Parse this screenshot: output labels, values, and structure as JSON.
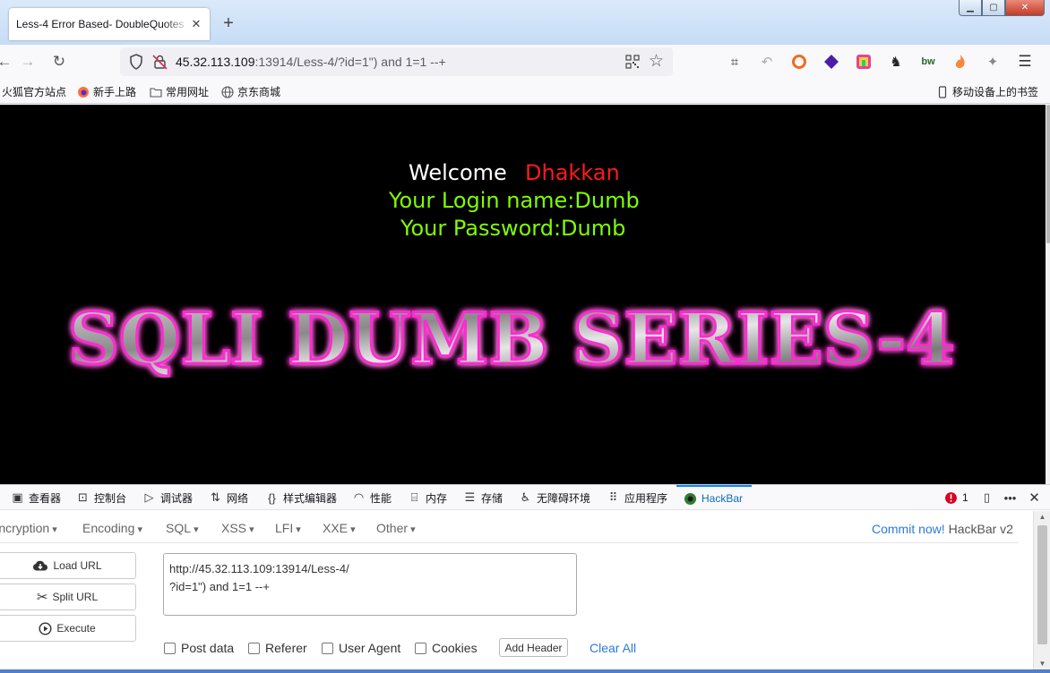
{
  "browser": {
    "tab_title": "Less-4 Error Based- DoubleQuotes",
    "new_tab_label": "+",
    "url_host": "45.32.113.109",
    "url_rest": ":13914/Less-4/?id=1\") and 1=1 --+",
    "bookmarks": [
      "火狐官方站点",
      "新手上路",
      "常用网址",
      "京东商城"
    ],
    "mobile_bookmarks": "移动设备上的书签"
  },
  "page": {
    "welcome": "Welcome",
    "user": "Dhakkan",
    "login_line": "Your Login name:Dumb",
    "password_line": "Your Password:Dumb",
    "banner": "SQLI DUMB SERIES-4"
  },
  "devtools": {
    "tabs": [
      "查看器",
      "控制台",
      "调试器",
      "网络",
      "样式编辑器",
      "性能",
      "内存",
      "存储",
      "无障碍环境",
      "应用程序",
      "HackBar"
    ],
    "error_count": "1"
  },
  "hackbar": {
    "menus": [
      "Encryption",
      "Encoding",
      "SQL",
      "XSS",
      "LFI",
      "XXE",
      "Other"
    ],
    "commit_link": "Commit now!",
    "version": "HackBar v2",
    "load_url": "Load URL",
    "split_url": "Split URL",
    "execute": "Execute",
    "url_value": "http://45.32.113.109:13914/Less-4/\n?id=1\") and 1=1 --+",
    "checks": [
      "Post data",
      "Referer",
      "User Agent",
      "Cookies"
    ],
    "add_header": "Add Header",
    "clear_all": "Clear All"
  },
  "colors": {
    "welcome": "#ffffff",
    "user": "#ff1a1a",
    "login": "#7fff00",
    "banner_glow": "#ff2ad4",
    "hackbar_link": "#2a7bd6",
    "devtools_active": "#0a84ff"
  }
}
